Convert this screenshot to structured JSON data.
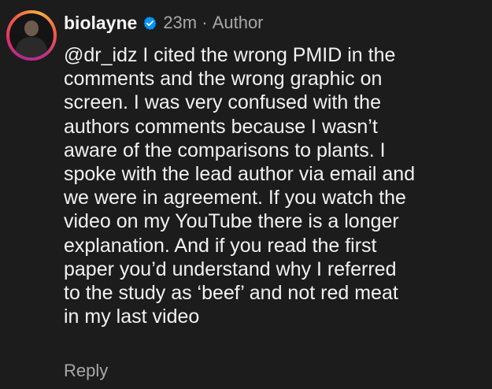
{
  "comment": {
    "username": "biolayne",
    "verified_icon": "verified-badge-icon",
    "time": "23m",
    "separator": "·",
    "role": "Author",
    "text_lines": [
      "@dr_idz I cited the wrong PMID in the",
      "comments and the wrong graphic on",
      "screen. I was very confused with the",
      "authors comments because I wasn’t",
      "aware of the comparisons to plants. I",
      "spoke with the lead author via email and",
      "we were in agreement. If you watch the",
      "video on my YouTube there is a longer",
      "explanation. And if you read the first",
      "paper you’d understand why I referred",
      "to the study as ‘beef’ and not red meat",
      "in my last video"
    ],
    "reply_label": "Reply"
  },
  "colors": {
    "background": "#1c1c1c",
    "text": "#f2f2f2",
    "secondary_text": "#a8a8a8",
    "verified_blue": "#0095f6"
  }
}
